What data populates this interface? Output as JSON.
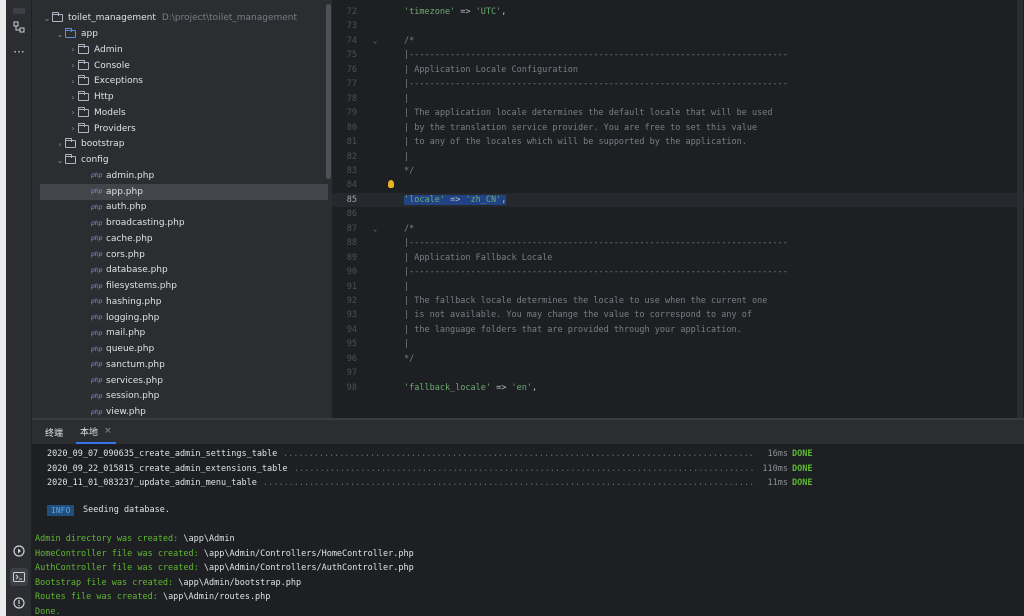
{
  "tool_strip": {
    "icons": [
      "structure-icon",
      "more-icon",
      "services-icon",
      "terminal-icon",
      "problems-icon"
    ],
    "more_glyph": "···"
  },
  "project_tree": {
    "root": {
      "name": "toilet_management",
      "path": "D:\\project\\toilet_management"
    },
    "items": [
      {
        "label": "app",
        "type": "folder"
      },
      {
        "label": "Admin",
        "type": "folder"
      },
      {
        "label": "Console",
        "type": "folder"
      },
      {
        "label": "Exceptions",
        "type": "folder"
      },
      {
        "label": "Http",
        "type": "folder"
      },
      {
        "label": "Models",
        "type": "folder"
      },
      {
        "label": "Providers",
        "type": "folder"
      },
      {
        "label": "bootstrap",
        "type": "folder"
      },
      {
        "label": "config",
        "type": "folder"
      },
      {
        "label": "admin.php",
        "type": "php"
      },
      {
        "label": "app.php",
        "type": "php",
        "selected": true
      },
      {
        "label": "auth.php",
        "type": "php"
      },
      {
        "label": "broadcasting.php",
        "type": "php"
      },
      {
        "label": "cache.php",
        "type": "php"
      },
      {
        "label": "cors.php",
        "type": "php"
      },
      {
        "label": "database.php",
        "type": "php"
      },
      {
        "label": "filesystems.php",
        "type": "php"
      },
      {
        "label": "hashing.php",
        "type": "php"
      },
      {
        "label": "logging.php",
        "type": "php"
      },
      {
        "label": "mail.php",
        "type": "php"
      },
      {
        "label": "queue.php",
        "type": "php"
      },
      {
        "label": "sanctum.php",
        "type": "php"
      },
      {
        "label": "services.php",
        "type": "php"
      },
      {
        "label": "session.php",
        "type": "php"
      },
      {
        "label": "view.php",
        "type": "php"
      }
    ],
    "php_badge": "php"
  },
  "editor": {
    "current_line": "85",
    "lines": [
      {
        "n": "72",
        "text": "'timezone' => 'UTC',",
        "kind": "kv"
      },
      {
        "n": "73",
        "text": "",
        "kind": "plain"
      },
      {
        "n": "74",
        "text": "/*",
        "kind": "comment",
        "fold": true
      },
      {
        "n": "75",
        "text": "|--------------------------------------------------------------------------",
        "kind": "comment"
      },
      {
        "n": "76",
        "text": "| Application Locale Configuration",
        "kind": "comment"
      },
      {
        "n": "77",
        "text": "|--------------------------------------------------------------------------",
        "kind": "comment"
      },
      {
        "n": "78",
        "text": "|",
        "kind": "comment"
      },
      {
        "n": "79",
        "text": "| The application locale determines the default locale that will be used",
        "kind": "comment"
      },
      {
        "n": "80",
        "text": "| by the translation service provider. You are free to set this value",
        "kind": "comment"
      },
      {
        "n": "81",
        "text": "| to any of the locales which will be supported by the application.",
        "kind": "comment"
      },
      {
        "n": "82",
        "text": "|",
        "kind": "comment"
      },
      {
        "n": "83",
        "text": "*/",
        "kind": "comment"
      },
      {
        "n": "84",
        "text": "",
        "kind": "plain",
        "bulb": true
      },
      {
        "n": "85",
        "text": "'locale' => 'zh_CN',",
        "kind": "kv"
      },
      {
        "n": "86",
        "text": "",
        "kind": "plain"
      },
      {
        "n": "87",
        "text": "/*",
        "kind": "comment",
        "fold": true
      },
      {
        "n": "88",
        "text": "|--------------------------------------------------------------------------",
        "kind": "comment"
      },
      {
        "n": "89",
        "text": "| Application Fallback Locale",
        "kind": "comment"
      },
      {
        "n": "90",
        "text": "|--------------------------------------------------------------------------",
        "kind": "comment"
      },
      {
        "n": "91",
        "text": "|",
        "kind": "comment"
      },
      {
        "n": "92",
        "text": "| The fallback locale determines the locale to use when the current one",
        "kind": "comment"
      },
      {
        "n": "93",
        "text": "| is not available. You may change the value to correspond to any of",
        "kind": "comment"
      },
      {
        "n": "94",
        "text": "| the language folders that are provided through your application.",
        "kind": "comment"
      },
      {
        "n": "95",
        "text": "|",
        "kind": "comment"
      },
      {
        "n": "96",
        "text": "*/",
        "kind": "comment"
      },
      {
        "n": "97",
        "text": "",
        "kind": "plain"
      },
      {
        "n": "98",
        "text": "'fallback_locale' => 'en',",
        "kind": "kv"
      }
    ]
  },
  "terminal": {
    "tabs": [
      {
        "label": "终端",
        "active": false
      },
      {
        "label": "本地",
        "active": true,
        "closable": true
      }
    ],
    "close_glyph": "×",
    "migrations": [
      {
        "name": "2020_09_07_090635_create_admin_settings_table",
        "time": "16ms",
        "status": "DONE"
      },
      {
        "name": "2020_09_22_015815_create_admin_extensions_table",
        "time": "110ms",
        "status": "DONE"
      },
      {
        "name": "2020_11_01_083237_update_admin_menu_table",
        "time": "11ms",
        "status": "DONE"
      }
    ],
    "info_badge": "INFO",
    "info_message": "Seeding database.",
    "output": [
      {
        "green": "Admin directory was created:",
        "white": " \\app\\Admin"
      },
      {
        "green": "HomeController file was created:",
        "white": " \\app\\Admin/Controllers/HomeController.php"
      },
      {
        "green": "AuthController file was created:",
        "white": " \\app\\Admin/Controllers/AuthController.php"
      },
      {
        "green": "Bootstrap file was created:",
        "white": " \\app\\Admin/bootstrap.php"
      },
      {
        "green": "Routes file was created:",
        "white": " \\app\\Admin/routes.php"
      },
      {
        "green": "Done.",
        "white": ""
      }
    ]
  },
  "colors": {
    "background": "#1e1f22",
    "panel": "#2b2d30",
    "string": "#6aab73",
    "comment": "#7a7e85",
    "done": "#5fb832",
    "selection": "#214283"
  }
}
